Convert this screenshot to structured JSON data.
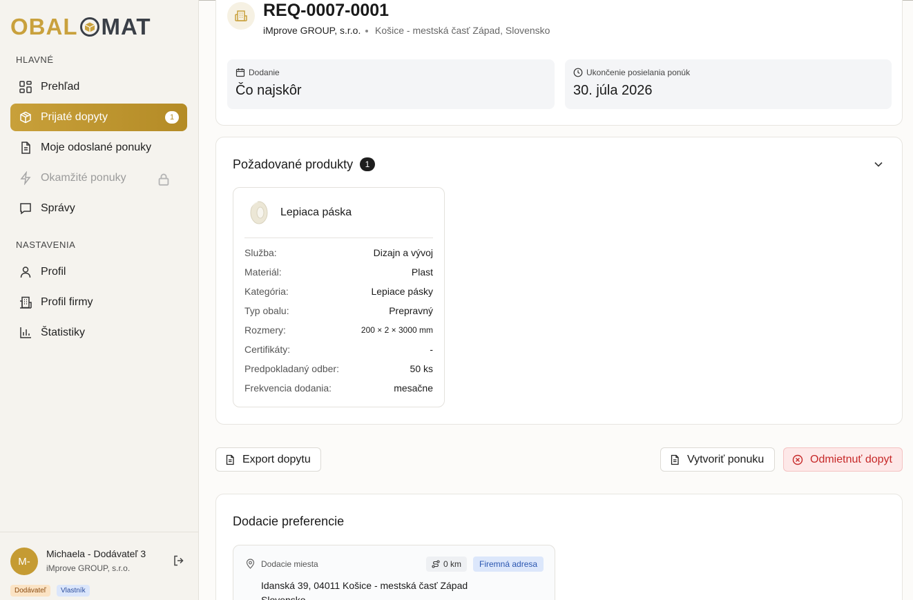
{
  "logo": {
    "part1": "OBAL",
    "part2": "MAT"
  },
  "sidebar": {
    "main_label": "HLAVNÉ",
    "settings_label": "NASTAVENIA",
    "items": [
      {
        "label": "Prehľad",
        "icon": "grid-icon"
      },
      {
        "label": "Prijaté dopyty",
        "icon": "package-icon",
        "badge": "1",
        "active": true
      },
      {
        "label": "Moje odoslané ponuky",
        "icon": "document-icon"
      },
      {
        "label": "Okamžité ponuky",
        "icon": "lightning-icon",
        "locked": true
      },
      {
        "label": "Správy",
        "icon": "chat-icon"
      }
    ],
    "settings_items": [
      {
        "label": "Profil",
        "icon": "user-icon"
      },
      {
        "label": "Profil firmy",
        "icon": "building-icon"
      },
      {
        "label": "Štatistiky",
        "icon": "chart-icon"
      }
    ],
    "user": {
      "initials": "M-",
      "name": "Michaela - Dodávateľ 3",
      "company": "iMprove GROUP, s.r.o.",
      "role_tag": "Dodávateľ",
      "owner_tag": "Vlastník"
    }
  },
  "request": {
    "id": "REQ-0007-0001",
    "company": "iMprove GROUP, s.r.o.",
    "location": "Košice - mestská časť Západ, Slovensko",
    "delivery_label": "Dodanie",
    "delivery_value": "Čo najskôr",
    "deadline_label": "Ukončenie posielania ponúk",
    "deadline_value": "30. júla 2026"
  },
  "products": {
    "title": "Požadované produkty",
    "count": "1",
    "item": {
      "name": "Lepiaca páska",
      "attributes": [
        {
          "key": "Služba:",
          "value": "Dizajn a vývoj"
        },
        {
          "key": "Materiál:",
          "value": "Plast"
        },
        {
          "key": "Kategória:",
          "value": "Lepiace pásky"
        },
        {
          "key": "Typ obalu:",
          "value": "Prepravný"
        },
        {
          "key": "Rozmery:",
          "value": "200 × 2 × 3000 mm"
        },
        {
          "key": "Certifikáty:",
          "value": "-"
        },
        {
          "key": "Predpokladaný odber:",
          "value": "50 ks"
        },
        {
          "key": "Frekvencia dodania:",
          "value": "mesačne"
        }
      ]
    }
  },
  "actions": {
    "export": "Export dopytu",
    "create": "Vytvoriť ponuku",
    "reject": "Odmietnuť dopyt"
  },
  "delivery_prefs": {
    "title": "Dodacie preferencie",
    "places_label": "Dodacie miesta",
    "distance": "0 km",
    "address_type": "Firemná adresa",
    "address_line1": "Idanská 39, 04011 Košice - mestská časť Západ",
    "address_line2": "Slovensko"
  },
  "colors": {
    "brand_gold": "#c59b33",
    "reject_red": "#c62828"
  }
}
